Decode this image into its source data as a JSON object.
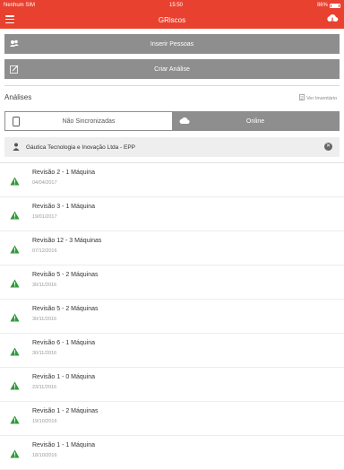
{
  "status_bar": {
    "carrier": "Nenhum SIM",
    "time": "15:50",
    "battery": "86%"
  },
  "nav": {
    "title": "GRiscos"
  },
  "actions": {
    "insert_people": "Inserir Pessoas",
    "create_analysis": "Criar Análise"
  },
  "section": {
    "title": "Análises",
    "inventory_link": "Ver Inventário"
  },
  "tabs": {
    "not_synced": "Não Sincronizadas",
    "online": "Online",
    "active": "online"
  },
  "company": {
    "name": "Gáutica Tecnologia e Inovação Ltda - EPP"
  },
  "colors": {
    "brand": "#e8412f",
    "warning": "#2e9a3b",
    "button": "#8e8e8e"
  },
  "analyses": [
    {
      "title": "Revisão 2 - 1 Máquina",
      "date": "04/04/2017"
    },
    {
      "title": "Revisão 3 - 1 Máquina",
      "date": "19/01/2017"
    },
    {
      "title": "Revisão 12 - 3 Máquinas",
      "date": "07/12/2016"
    },
    {
      "title": "Revisão 5 - 2 Máquinas",
      "date": "30/11/2016"
    },
    {
      "title": "Revisão 5 - 2 Máquinas",
      "date": "30/11/2016"
    },
    {
      "title": "Revisão 6 - 1 Máquina",
      "date": "30/11/2016"
    },
    {
      "title": "Revisão 1 - 0 Máquina",
      "date": "23/11/2016"
    },
    {
      "title": "Revisão 1 - 2 Máquinas",
      "date": "19/10/2016"
    },
    {
      "title": "Revisão 1 - 1 Máquina",
      "date": "18/10/2016"
    }
  ]
}
